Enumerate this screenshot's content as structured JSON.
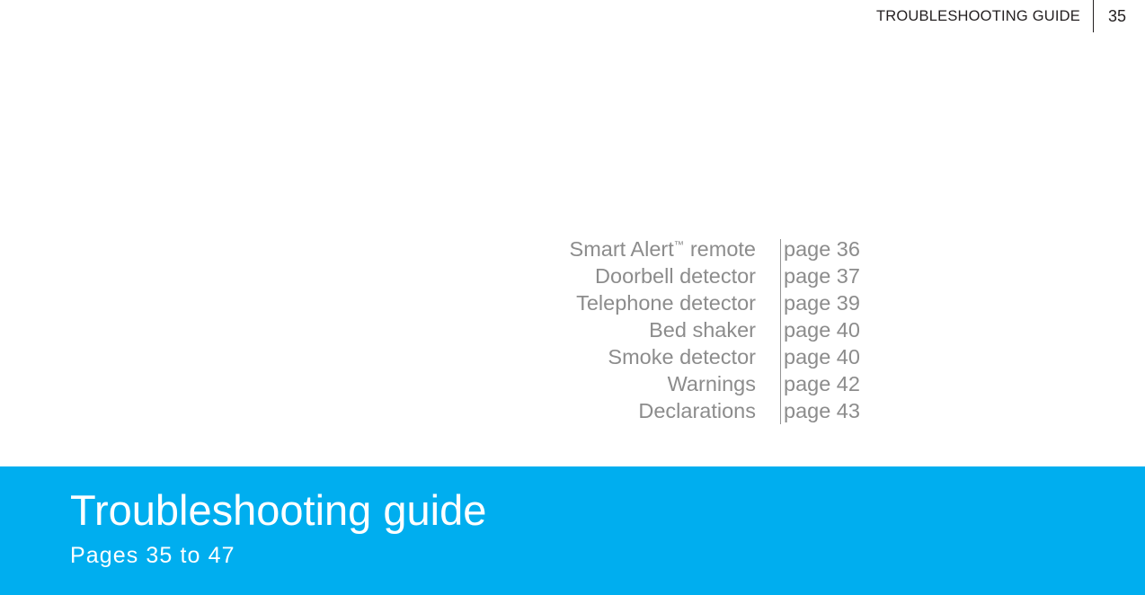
{
  "header": {
    "chapter_title": "TROUBLESHOOTING GUIDE",
    "folio": "35"
  },
  "toc": {
    "entries": [
      {
        "label": "Smart Alert",
        "superscript": "™",
        "label_suffix": " remote",
        "page": "page 36"
      },
      {
        "label": "Doorbell detector",
        "superscript": "",
        "label_suffix": "",
        "page": "page 37"
      },
      {
        "label": "Telephone detector",
        "superscript": "",
        "label_suffix": "",
        "page": "page 39"
      },
      {
        "label": "Bed shaker",
        "superscript": "",
        "label_suffix": "",
        "page": "page 40"
      },
      {
        "label": "Smoke detector",
        "superscript": "",
        "label_suffix": "",
        "page": "page 40"
      },
      {
        "label": "Warnings",
        "superscript": "",
        "label_suffix": "",
        "page": "page 42"
      },
      {
        "label": "Declarations",
        "superscript": "",
        "label_suffix": "",
        "page": "page 43"
      }
    ]
  },
  "banner": {
    "title": "Troubleshooting guide",
    "subtitle": "Pages 35 to 47",
    "background_color": "#00aeef",
    "text_color": "#ffffff"
  },
  "colors": {
    "accent": "#00aeef",
    "toc_text": "#8c8c8c",
    "header_text": "#231f20",
    "rule": "#949494",
    "page_background": "#ffffff"
  }
}
